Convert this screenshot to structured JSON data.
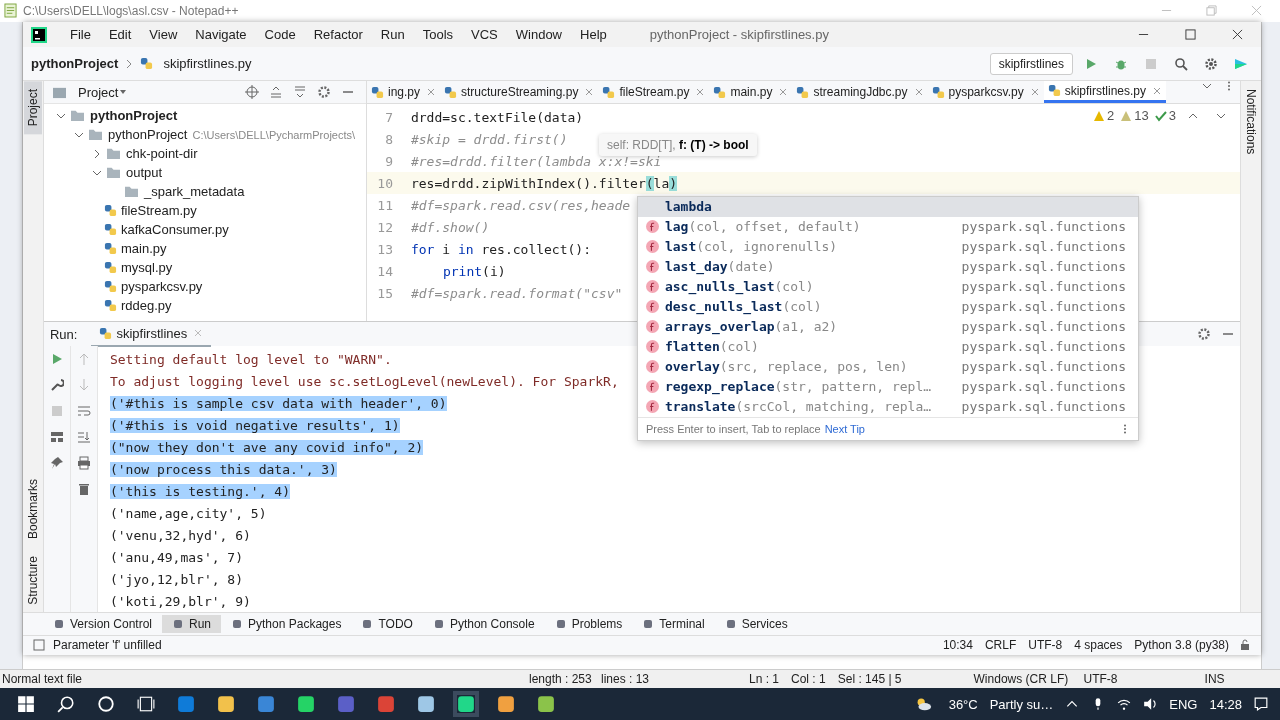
{
  "notepad": {
    "title": "C:\\Users\\DELL\\logs\\asl.csv - Notepad++",
    "file_type": "Normal text file",
    "length": "length : 253",
    "lines": "lines : 13",
    "position": [
      "Ln : 1",
      "Col : 1",
      "Sel : 145 | 5"
    ],
    "eol": "Windows (CR LF)",
    "encoding": "UTF-8",
    "mode": "INS"
  },
  "ide": {
    "menu": [
      "File",
      "Edit",
      "View",
      "Navigate",
      "Code",
      "Refactor",
      "Run",
      "Tools",
      "VCS",
      "Window",
      "Help"
    ],
    "title": "pythonProject - skipfirstlines.py",
    "breadcrumb": [
      "pythonProject",
      "skipfirstlines.py"
    ],
    "run_config": "skipfirstlines",
    "left_tools": [
      {
        "label": "Project",
        "selected": true
      }
    ],
    "left_tools_bottom": [
      "Bookmarks",
      "Structure"
    ],
    "right_tool": "Notifications",
    "project_panel": {
      "title": "Project",
      "tree": [
        {
          "label": "pythonProject",
          "kind": "folder",
          "expanded": true,
          "children": [
            {
              "label": "pythonProject",
              "kind": "folder",
              "expanded": true,
              "path": "C:\\Users\\DELL\\PycharmProjects\\",
              "children": [
                {
                  "label": "chk-point-dir",
                  "kind": "folder",
                  "expanded": false
                },
                {
                  "label": "output",
                  "kind": "folder",
                  "expanded": true,
                  "children": [
                    {
                      "label": "_spark_metadata",
                      "kind": "folder"
                    }
                  ]
                },
                {
                  "label": "fileStream.py",
                  "kind": "file"
                },
                {
                  "label": "kafkaConsumer.py",
                  "kind": "file"
                },
                {
                  "label": "main.py",
                  "kind": "file"
                },
                {
                  "label": "mysql.py",
                  "kind": "file"
                },
                {
                  "label": "pysparkcsv.py",
                  "kind": "file"
                },
                {
                  "label": "rddeg.py",
                  "kind": "file"
                }
              ]
            }
          ]
        }
      ]
    },
    "editor_tabs": [
      {
        "label": "ing.py",
        "selected": false
      },
      {
        "label": "structureStreaming.py",
        "selected": false
      },
      {
        "label": "fileStream.py",
        "selected": false
      },
      {
        "label": "main.py",
        "selected": false
      },
      {
        "label": "streamingJdbc.py",
        "selected": false
      },
      {
        "label": "pysparkcsv.py",
        "selected": false
      },
      {
        "label": "skipfirstlines.py",
        "selected": true
      }
    ],
    "inspections": [
      {
        "kind": "warning",
        "count": "2"
      },
      {
        "kind": "weak",
        "count": "13"
      },
      {
        "kind": "typo",
        "count": "3"
      }
    ],
    "code_lines": [
      {
        "number": "7",
        "current": false,
        "segments": [
          {
            "kind": "plain",
            "text": "drdd=sc.textFile(data)"
          }
        ]
      },
      {
        "number": "8",
        "current": false,
        "segments": [
          {
            "kind": "comment",
            "text": "#skip = drdd.first()"
          }
        ]
      },
      {
        "number": "9",
        "current": false,
        "segments": [
          {
            "kind": "comment",
            "text": "#res=drdd.filter(lambda x:x!=ski"
          }
        ]
      },
      {
        "number": "10",
        "current": true,
        "segments": [
          {
            "kind": "plain",
            "text": "res=drdd.zipWithIndex().filter"
          },
          {
            "kind": "brace",
            "text": "("
          },
          {
            "kind": "plain",
            "text": "la"
          },
          {
            "kind": "brace",
            "text": ")"
          }
        ]
      },
      {
        "number": "11",
        "current": false,
        "segments": [
          {
            "kind": "comment",
            "text": "#df=spark.read.csv(res,heade"
          }
        ]
      },
      {
        "number": "12",
        "current": false,
        "segments": [
          {
            "kind": "comment",
            "text": "#df.show()"
          }
        ]
      },
      {
        "number": "13",
        "current": false,
        "segments": [
          {
            "kind": "keyword",
            "text": "for"
          },
          {
            "kind": "plain",
            "text": " i "
          },
          {
            "kind": "keyword",
            "text": "in"
          },
          {
            "kind": "plain",
            "text": " res.collect():"
          }
        ]
      },
      {
        "number": "14",
        "current": false,
        "indented": true,
        "segments": [
          {
            "kind": "builtin",
            "text": "print"
          },
          {
            "kind": "plain",
            "text": "(i)"
          }
        ]
      },
      {
        "number": "15",
        "current": false,
        "segments": [
          {
            "kind": "comment",
            "text": "#df=spark.read.format(\"csv\""
          }
        ]
      }
    ],
    "param_hint": "self: RDD[T], **f: (T) -> bool**",
    "completion": {
      "items": [
        {
          "kind": "keyword",
          "name": "lambda",
          "selected": true
        },
        {
          "kind": "function",
          "name": "lag",
          "params": "(col, offset, default)",
          "source": "pyspark.sql.functions",
          "selected": false
        },
        {
          "kind": "function",
          "name": "last",
          "params": "(col, ignorenulls)",
          "source": "pyspark.sql.functions",
          "selected": false
        },
        {
          "kind": "function",
          "name": "last_day",
          "params": "(date)",
          "source": "pyspark.sql.functions",
          "selected": false
        },
        {
          "kind": "function",
          "name": "asc_nulls_last",
          "params": "(col)",
          "source": "pyspark.sql.functions",
          "selected": false
        },
        {
          "kind": "function",
          "name": "desc_nulls_last",
          "params": "(col)",
          "source": "pyspark.sql.functions",
          "selected": false
        },
        {
          "kind": "function",
          "name": "arrays_overlap",
          "params": "(a1, a2)",
          "source": "pyspark.sql.functions",
          "selected": false
        },
        {
          "kind": "function",
          "name": "flatten",
          "params": "(col)",
          "source": "pyspark.sql.functions",
          "selected": false
        },
        {
          "kind": "function",
          "name": "overlay",
          "params": "(src, replace, pos, len)",
          "source": "pyspark.sql.functions",
          "selected": false
        },
        {
          "kind": "function",
          "name": "regexp_replace",
          "params": "(str, pattern, repl…",
          "source": "pyspark.sql.functions",
          "selected": false
        },
        {
          "kind": "function",
          "name": "translate",
          "params": "(srcCol, matching, repla…",
          "source": "pyspark.sql.functions",
          "selected": false
        }
      ],
      "footer": "Press Enter to insert, Tab to replace",
      "tip_link": "Next Tip"
    },
    "run_panel": {
      "label": "Run:",
      "tab": "skipfirstlines",
      "lines": [
        {
          "kind": "log",
          "text": "Setting default log level to \"WARN\".",
          "selected": false
        },
        {
          "kind": "log",
          "text": "To adjust logging level use sc.setLogLevel(newLevel). For SparkR,",
          "selected": false
        },
        {
          "kind": "output",
          "text": "('#this is sample csv data with header', 0)",
          "selected": true
        },
        {
          "kind": "output",
          "text": "('#this is void negative results', 1)",
          "selected": true
        },
        {
          "kind": "output",
          "text": "(\"now they don't ave any covid info\", 2)",
          "selected": true
        },
        {
          "kind": "output",
          "text": "('now process this data.', 3)",
          "selected": true
        },
        {
          "kind": "output",
          "text": "('this is testing.', 4)",
          "selected": true
        },
        {
          "kind": "output",
          "text": "('name,age,city', 5)",
          "selected": false
        },
        {
          "kind": "output",
          "text": "('venu,32,hyd', 6)",
          "selected": false
        },
        {
          "kind": "output",
          "text": "('anu,49,mas', 7)",
          "selected": false
        },
        {
          "kind": "output",
          "text": "('jyo,12,blr', 8)",
          "selected": false
        },
        {
          "kind": "output",
          "text": "('koti,29,blr', 9)",
          "selected": false
        }
      ]
    },
    "tool_tabs": [
      {
        "label": "Version Control",
        "selected": false
      },
      {
        "label": "Run",
        "selected": true
      },
      {
        "label": "Python Packages",
        "selected": false
      },
      {
        "label": "TODO",
        "selected": false
      },
      {
        "label": "Python Console",
        "selected": false
      },
      {
        "label": "Problems",
        "selected": false
      },
      {
        "label": "Terminal",
        "selected": false
      },
      {
        "label": "Services",
        "selected": false
      }
    ],
    "status": {
      "message": "Parameter 'f' unfilled",
      "items": [
        "10:34",
        "CRLF",
        "UTF-8",
        "4 spaces",
        "Python 3.8 (py38)"
      ]
    }
  },
  "taskbar": {
    "temperature": "36°C",
    "weather": "Partly su…",
    "language": "ENG",
    "time": "14:28"
  }
}
